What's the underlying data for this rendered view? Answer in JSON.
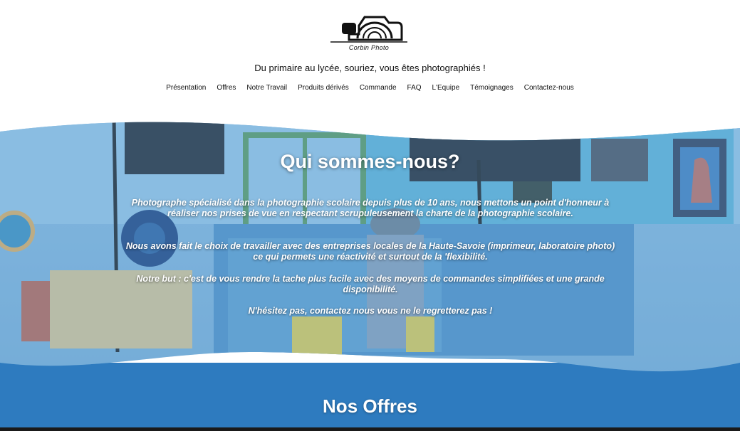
{
  "header": {
    "logo_text": "Corbin Photo",
    "tagline": "Du primaire au lycée, souriez, vous êtes photographiés !"
  },
  "nav": {
    "items": [
      "Présentation",
      "Offres",
      "Notre Travail",
      "Produits dérivés",
      "Commande",
      "FAQ",
      "L'Equipe",
      "Témoignages",
      "Contactez-nous"
    ]
  },
  "hero": {
    "title": "Qui sommes-nous?",
    "paragraphs": [
      "Photographe spécialisé dans la photographie scolaire depuis plus de 10 ans, nous mettons un point d'honneur à réaliser nos prises de vue en respectant scrupuleusement la charte de la photographie scolaire.",
      "Nous avons fait le choix de travailler avec des entreprises locales de la Haute-Savoie (imprimeur, laboratoire photo) ce qui permets une réactivité et surtout de la 'flexibilité.",
      "Notre but : c'est de vous rendre la tache plus facile avec des moyens de commandes simplifiées et une grande disponibilité.",
      "N'hésitez pas, contactez nous vous ne le regretterez pas !"
    ]
  },
  "offers": {
    "title": "Nos Offres"
  },
  "colors": {
    "accent_blue": "#2e7bbf",
    "hero_overlay": "#6aa6d6"
  }
}
